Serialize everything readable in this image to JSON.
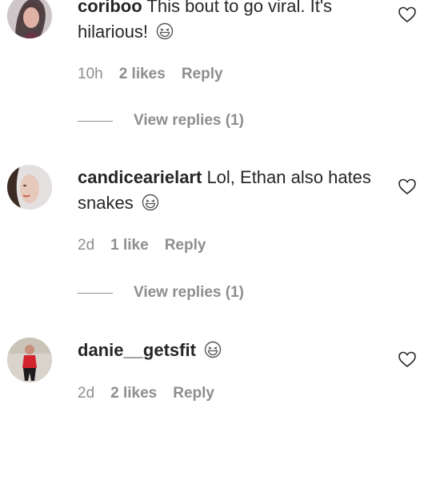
{
  "comments": [
    {
      "username": "coriboo",
      "text": "This bout to go viral. It's hilarious!",
      "emoji": "grinning-squint-emoji",
      "time": "10h",
      "likes": "2 likes",
      "reply_label": "Reply",
      "view_replies": "View replies (1)"
    },
    {
      "username": "candicearielart",
      "text": "Lol, Ethan also hates snakes",
      "emoji": "grinning-squint-emoji",
      "time": "2d",
      "likes": "1 like",
      "reply_label": "Reply",
      "view_replies": "View replies (1)"
    },
    {
      "username": "danie__getsfit",
      "text": "",
      "emoji": "grinning-squint-emoji",
      "time": "2d",
      "likes": "2 likes",
      "reply_label": "Reply"
    }
  ],
  "icons": {
    "like": "heart-outline-icon"
  },
  "colors": {
    "text": "#262626",
    "muted": "#8e8e8e"
  }
}
